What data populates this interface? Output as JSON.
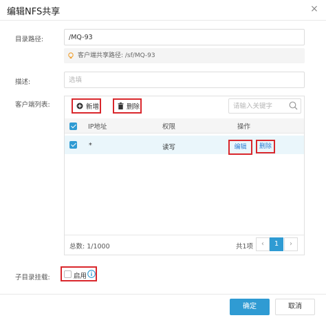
{
  "dialog": {
    "title": "编辑NFS共享",
    "close_glyph": "×"
  },
  "form": {
    "dir_label": "目录路径:",
    "dir_value": "/MQ-93",
    "client_path_hint": "客户端共享路径: /sf/MQ-93",
    "desc_label": "描述:",
    "desc_placeholder": "选填",
    "client_list_label": "客户端列表:",
    "subdir_label": "子目录挂载:",
    "subdir_enable_label": "启用",
    "subdir_enabled": false
  },
  "toolbar": {
    "add_label": "新增",
    "delete_label": "删除",
    "search_placeholder": "请输入关键字"
  },
  "table": {
    "columns": [
      "IP地址",
      "权限",
      "操作"
    ],
    "rows": [
      {
        "ip": "*",
        "permission": "读写",
        "edit_label": "编辑",
        "delete_label": "删除",
        "selected": true
      }
    ]
  },
  "pagination": {
    "total_text": "总数: 1/1000",
    "pages_text": "共1项",
    "prev_glyph": "‹",
    "current_page": "1",
    "next_glyph": "›"
  },
  "actions": {
    "ok_label": "确定",
    "cancel_label": "取消"
  },
  "colors": {
    "accent": "#2f9bd3",
    "highlight_border": "#d9262b",
    "hint_icon": "#f0a030",
    "info_icon": "#2f9bd3"
  }
}
